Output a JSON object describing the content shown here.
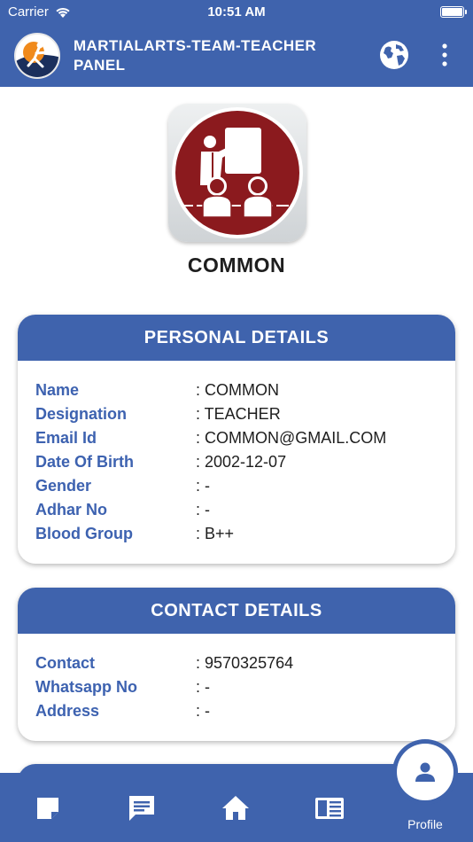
{
  "status_bar": {
    "carrier": "Carrier",
    "time": "10:51 AM"
  },
  "app_bar": {
    "title": "MARTIALARTS-TEAM-TEACHER PANEL",
    "icons": [
      "app-logo",
      "globe-icon",
      "more-vert-icon"
    ]
  },
  "profile": {
    "name": "COMMON",
    "avatar_icon": "teacher-presentation-icon"
  },
  "personal": {
    "title": "PERSONAL DETAILS",
    "rows": [
      {
        "label": "Name",
        "value": ": COMMON"
      },
      {
        "label": "Designation",
        "value": ": TEACHER"
      },
      {
        "label": "Email Id",
        "value": ": COMMON@GMAIL.COM"
      },
      {
        "label": "Date Of Birth",
        "value": ": 2002-12-07"
      },
      {
        "label": "Gender",
        "value": ":  -"
      },
      {
        "label": "Adhar No",
        "value": ":  -"
      },
      {
        "label": "Blood Group",
        "value": ": B++"
      }
    ]
  },
  "contact": {
    "title": "CONTACT DETAILS",
    "rows": [
      {
        "label": "Contact",
        "value": ": 9570325764"
      },
      {
        "label": "Whatsapp No",
        "value": ":  -"
      },
      {
        "label": "Address",
        "value": ":  -"
      }
    ]
  },
  "bottom_nav": {
    "items": [
      "note-icon",
      "chat-icon",
      "home-icon",
      "newspaper-icon"
    ],
    "active": {
      "icon": "person-icon",
      "label": "Profile"
    }
  },
  "colors": {
    "primary": "#3f63ad",
    "label_blue": "#3d62b0",
    "avatar_red": "#8b1a1e"
  }
}
